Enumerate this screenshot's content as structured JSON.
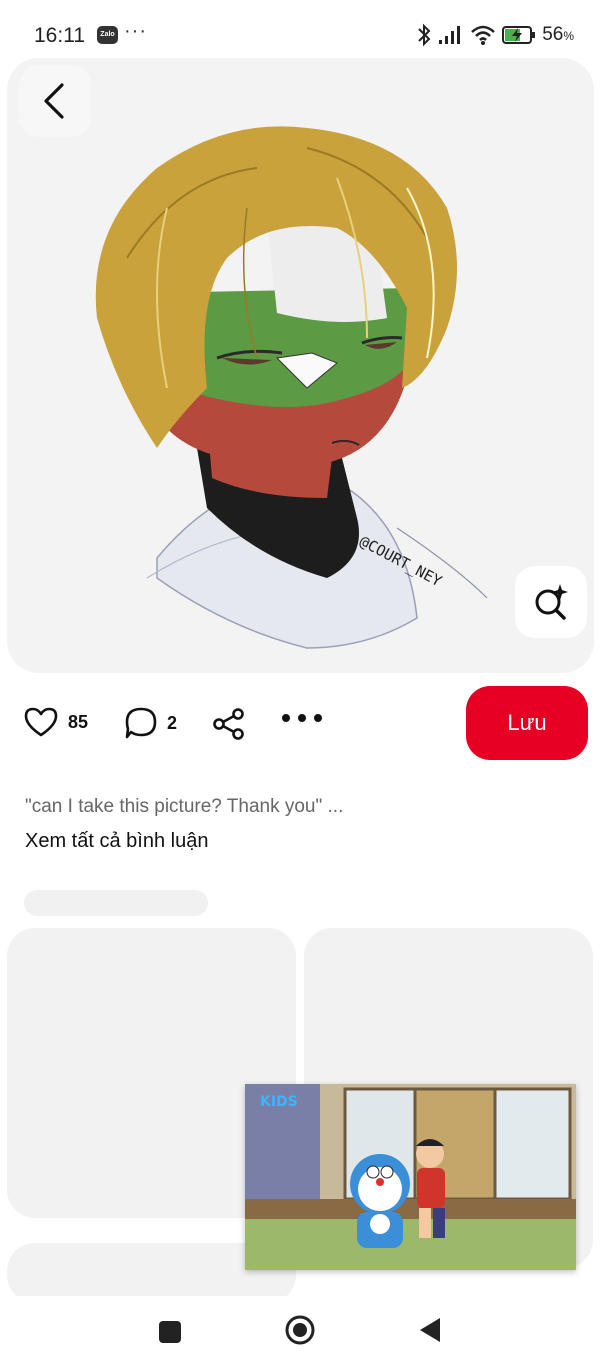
{
  "status_bar": {
    "time": "16:11",
    "zalo_label": "Zalo",
    "dots": "···",
    "battery_percent": "56",
    "battery_unit": "%"
  },
  "pin": {
    "artist_tag": "@COURT_NEY",
    "likes": "85",
    "comments": "2",
    "save_label": "Lưu"
  },
  "comments": {
    "preview": "\"can I take this picture? Thank you\" ...",
    "view_all": "Xem tất cả bình luận"
  },
  "pip": {
    "logo": "KIDS"
  },
  "icons": {
    "back": "chevron-left-icon",
    "lens": "visual-search-icon",
    "like": "heart-icon",
    "comment": "comment-bubble-icon",
    "share": "share-icon",
    "more": "more-dots-icon"
  },
  "colors": {
    "accent": "#e60023",
    "card_bg": "#f3f3f3"
  }
}
